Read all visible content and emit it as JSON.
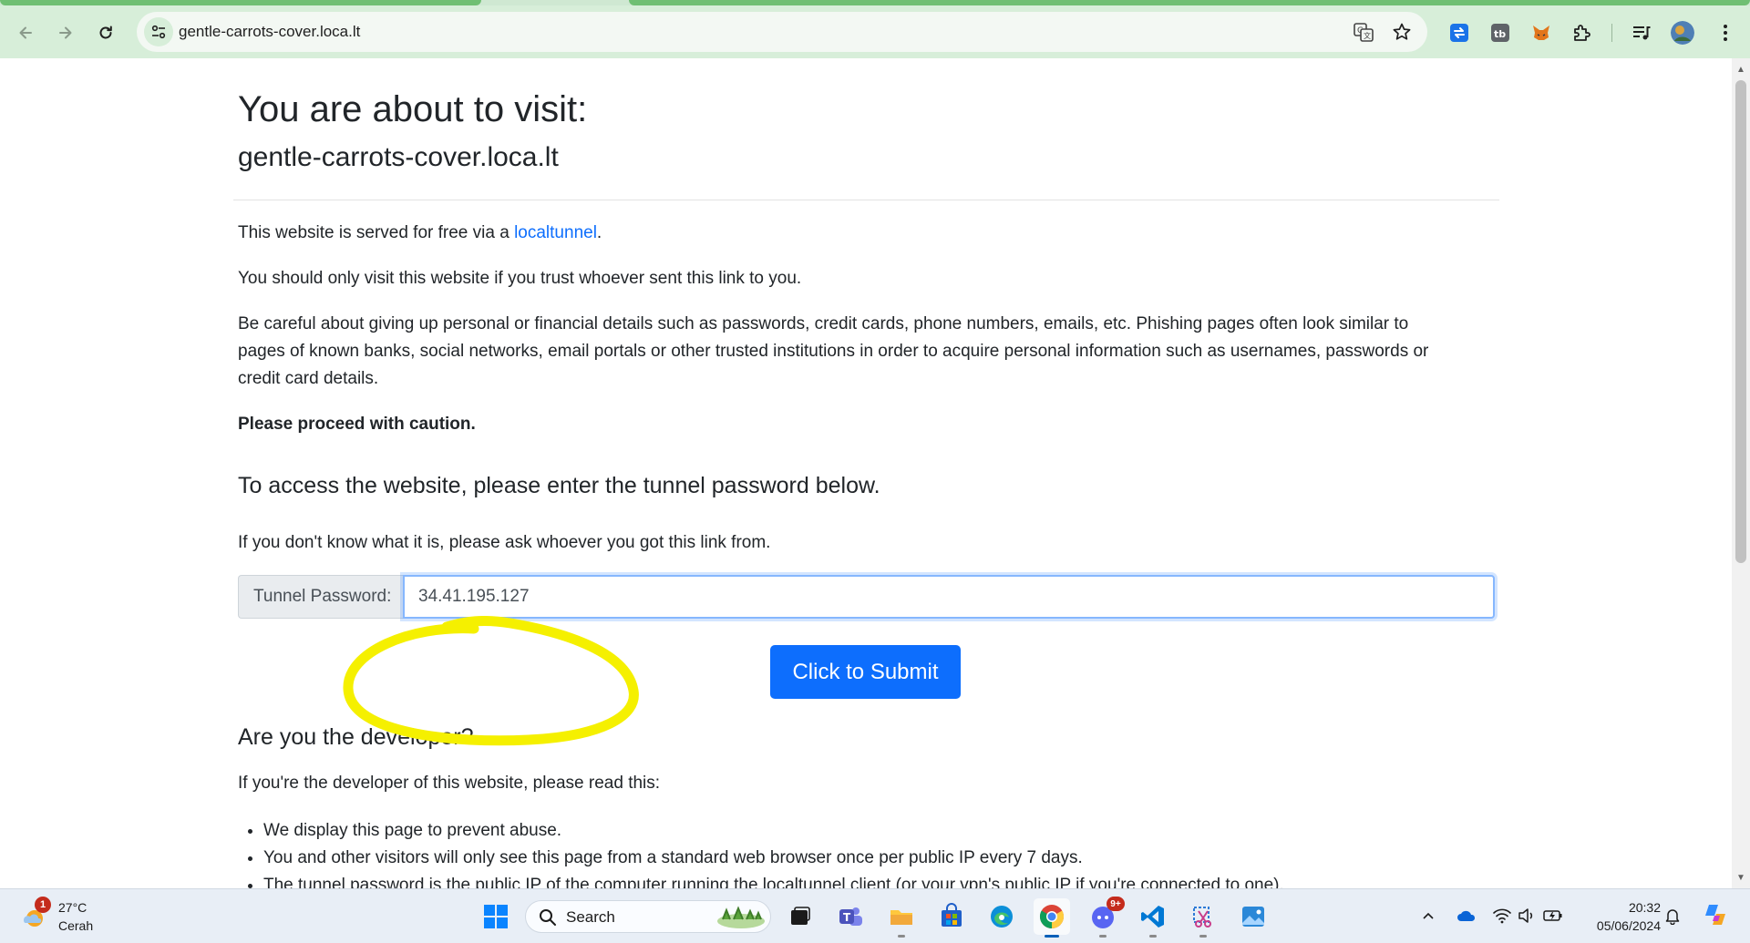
{
  "browser": {
    "url": "gentle-carrots-cover.loca.lt"
  },
  "page": {
    "heading": "You are about to visit:",
    "host": "gentle-carrots-cover.loca.lt",
    "intro_prefix": "This website is served for free via a ",
    "intro_link": "localtunnel",
    "intro_suffix": ".",
    "trust_text": "You should only visit this website if you trust whoever sent this link to you.",
    "warning_line1": "Be careful about giving up personal or financial details such as passwords, credit cards, phone numbers, emails, etc. Phishing pages often look similar to",
    "warning_line2": "pages of known banks, social networks, email portals or other trusted institutions in order to acquire personal information such as usernames, passwords or",
    "warning_line3": "credit card details.",
    "caution": "Please proceed with caution.",
    "password_heading": "To access the website, please enter the tunnel password below.",
    "password_hint": "If you don't know what it is, please ask whoever you got this link from.",
    "password_label": "Tunnel Password:",
    "password_value": "34.41.195.127",
    "submit_label": "Click to Submit",
    "developer_heading": "Are you the developer?",
    "developer_text": "If you're the developer of this website, please read this:",
    "developer_items": [
      "We display this page to prevent abuse.",
      "You and other visitors will only see this page from a standard web browser once per public IP every 7 days.",
      "The tunnel password is the public IP of the computer running the localtunnel client (or your vpn's public IP if you're connected to one)."
    ],
    "highlight_color": "#f5f000"
  },
  "taskbar": {
    "weather_badge": "1",
    "temperature": "27°C",
    "condition": "Cerah",
    "search_label": "Search",
    "time": "20:32",
    "date": "05/06/2024",
    "teams_badge": "9+"
  }
}
